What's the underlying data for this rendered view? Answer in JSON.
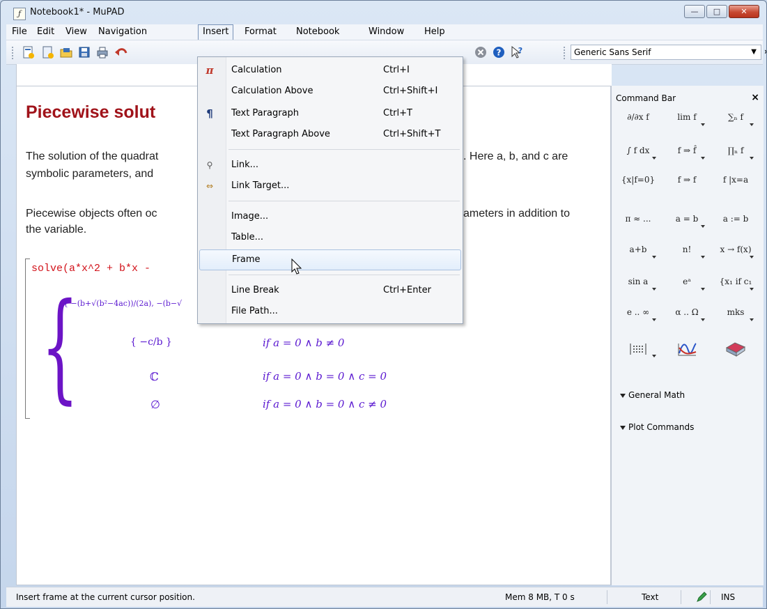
{
  "window": {
    "title": "Notebook1* - MuPAD",
    "app_icon": "mupad-icon",
    "controls": {
      "minimize": "—",
      "maximize": "□",
      "close": "✕"
    }
  },
  "menubar": {
    "items": [
      "File",
      "Edit",
      "View",
      "Navigation",
      "Insert",
      "Format",
      "Notebook",
      "Window",
      "Help"
    ],
    "open_menu": "Insert"
  },
  "toolbar": {
    "font": "Generic Sans Serif",
    "overflow": "»",
    "icons": [
      "new-notebook-icon",
      "new-from-template-icon",
      "open-icon",
      "save-icon",
      "print-icon",
      "undo-icon",
      "stop-icon",
      "help-icon",
      "context-help-icon"
    ]
  },
  "insert_menu": {
    "items": [
      {
        "label": "Calculation",
        "shortcut": "Ctrl+I",
        "icon": "pi-icon"
      },
      {
        "label": "Calculation Above",
        "shortcut": "Ctrl+Shift+I",
        "icon": ""
      },
      {
        "label": "Text Paragraph",
        "shortcut": "Ctrl+T",
        "icon": "paragraph-icon"
      },
      {
        "label": "Text Paragraph Above",
        "shortcut": "Ctrl+Shift+T",
        "icon": ""
      },
      {
        "label": "Link...",
        "shortcut": "",
        "icon": "link-icon"
      },
      {
        "label": "Link Target...",
        "shortcut": "",
        "icon": "link-target-icon"
      },
      {
        "label": "Image...",
        "shortcut": "",
        "icon": ""
      },
      {
        "label": "Table...",
        "shortcut": "",
        "icon": ""
      },
      {
        "label": "Frame",
        "shortcut": "",
        "icon": ""
      },
      {
        "label": "Line Break",
        "shortcut": "Ctrl+Enter",
        "icon": ""
      },
      {
        "label": "File Path...",
        "shortcut": "",
        "icon": ""
      }
    ],
    "highlighted": "Frame"
  },
  "document": {
    "heading": "Piecewise solut",
    "para1_line1_left": "The solution of the quadrat",
    "para1_line1_right": ". Here a, b, and c are",
    "para1_line2": "symbolic parameters, and",
    "para2_line1_left": "Piecewise objects often oc",
    "para2_line1_right": "ameters in addition to",
    "para2_line2": "the variable.",
    "input": "solve(a*x^2 + b*x -",
    "result": {
      "row1_math": "{ −(b+√(b²−4ac))/(2a), −(b−√",
      "row2_math": "{ −c/b }",
      "row2_cond": "if a = 0 ∧ b ≠ 0",
      "row3_math": "ℂ",
      "row3_cond": "if a = 0 ∧ b = 0 ∧ c = 0",
      "row4_math": "∅",
      "row4_cond": "if a = 0 ∧ b = 0 ∧ c ≠ 0"
    }
  },
  "command_bar": {
    "title": "Command Bar",
    "close": "×",
    "buttons": [
      "∂/∂x f",
      "lim f",
      "∑ₙ f",
      "∫ f dx",
      "f ⇒ f̂",
      "∏ₙ f",
      "{x|f=0}",
      "f ⇒ f",
      "f |x=a",
      "π ≈ ...",
      "a = b",
      "a := b",
      "a+b",
      "n!",
      "x → f(x)",
      "sin a",
      "eᵃ",
      "{x₁ if c₁",
      "e .. ∞",
      "α .. Ω",
      "mks"
    ],
    "sections": [
      "General Math",
      "Plot Commands"
    ]
  },
  "statusbar": {
    "message": "Insert frame at the current cursor position.",
    "memory": "Mem 8 MB, T 0 s",
    "mode": "Text",
    "insert_mode": "INS"
  }
}
